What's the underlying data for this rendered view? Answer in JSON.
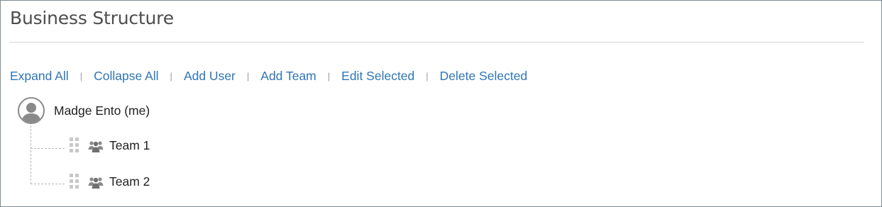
{
  "page": {
    "title": "Business Structure"
  },
  "toolbar": {
    "expand_all": "Expand All",
    "collapse_all": "Collapse All",
    "add_user": "Add User",
    "add_team": "Add Team",
    "edit_selected": "Edit Selected",
    "delete_selected": "Delete Selected",
    "separator": "|"
  },
  "tree": {
    "root": {
      "label": "Madge Ento (me)",
      "icon": "user-avatar-icon"
    },
    "teams": [
      {
        "label": "Team 1",
        "icon": "team-icon"
      },
      {
        "label": "Team 2",
        "icon": "team-icon"
      }
    ]
  },
  "colors": {
    "link": "#2f75b5",
    "border": "#7f8a96",
    "text": "#222222",
    "icon_gray": "#8a8a8a"
  }
}
